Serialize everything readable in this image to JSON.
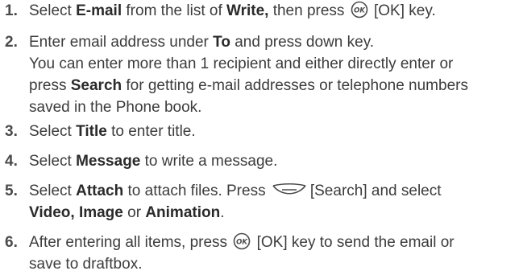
{
  "steps": [
    {
      "number": "1.",
      "parts": [
        "Select ",
        "E-mail",
        " from the list of ",
        "Write,",
        " then press ",
        "[OK] key."
      ]
    },
    {
      "number": "2.",
      "line1": [
        "Enter email address under ",
        "To",
        " and press down key."
      ],
      "line2": "You can enter more than 1 recipient and either directly enter or",
      "line3": [
        "press ",
        "Search",
        " for getting e-mail addresses or telephone numbers"
      ],
      "line4": "saved in the Phone book."
    },
    {
      "number": "3.",
      "parts": [
        "Select ",
        "Title",
        " to enter title."
      ]
    },
    {
      "number": "4.",
      "parts": [
        "Select ",
        "Message",
        " to write a message."
      ]
    },
    {
      "number": "5.",
      "line1": [
        "Select ",
        "Attach",
        " to attach files. Press ",
        "[Search] and select"
      ],
      "line2": [
        "Video, Image",
        " or ",
        "Animation",
        "."
      ]
    },
    {
      "number": "6.",
      "line1": [
        "After entering all items, press ",
        "[OK] key to send the email or"
      ],
      "line2": "save to draftbox."
    }
  ],
  "icons": {
    "ok_key": "ok-key-icon",
    "ok_key_label": "OK",
    "softkey": "left-softkey-icon"
  },
  "colors": {
    "text": "#3c3c3c",
    "icon_stroke": "#4a4a4a"
  }
}
